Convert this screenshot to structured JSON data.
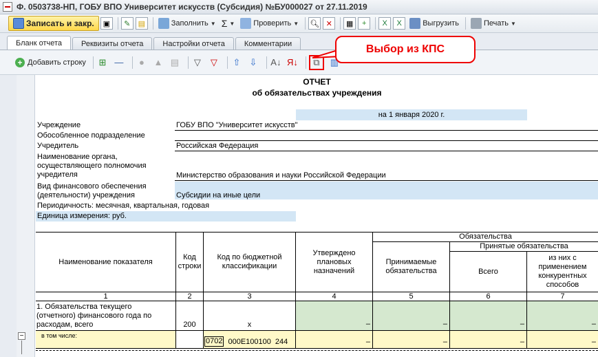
{
  "window": {
    "title": "Ф. 0503738-НП, ГОБУ ВПО Университет искусств (Субсидия) №БУ000027 от 27.11.2019"
  },
  "toolbar": {
    "save_close": "Записать и закр.",
    "fill": "Заполнить",
    "check": "Проверить",
    "upload": "Выгрузить",
    "print": "Печать"
  },
  "tabs": [
    "Бланк отчета",
    "Реквизиты отчета",
    "Настройки отчета",
    "Комментарии"
  ],
  "toolbar2": {
    "add_row": "Добавить строку"
  },
  "callout": "Выбор из КПС",
  "report": {
    "title": "ОТЧЕТ",
    "subtitle": "об обязательствах учреждения",
    "date": "на 1 января 2020 г.",
    "rows": [
      {
        "label": "Учреждение",
        "value": "ГОБУ ВПО \"Университет искусств\""
      },
      {
        "label": "Обособленное подразделение",
        "value": ""
      },
      {
        "label": "Учредитель",
        "value": "Российская Федерация"
      },
      {
        "label": "Наименование органа,\nосуществляющего полномочия\nучредителя",
        "value": "Министерство образования и науки Российской Федерации"
      },
      {
        "label": "Вид финансового обеспечения\n(деятельности) учреждения",
        "value": "Субсидии на иные цели"
      }
    ],
    "periodicity": "Периодичность: месячная, квартальная, годовая",
    "unit": "Единица измерения: руб."
  },
  "table": {
    "headers": {
      "name": "Наименование показателя",
      "code": "Код\nстроки",
      "kbk": "Код по бюджетной\nклассификации",
      "approved": "Утверждено\nплановых\nназначений",
      "obligations": "Обязательства",
      "accepted_group": "Принятые обязательства",
      "acceptable": "Принимаемые\nобязательства",
      "total": "Всего",
      "competitive": "из них с\nприменением\nконкурентных\nспособов"
    },
    "col_numbers": [
      "1",
      "2",
      "3",
      "4",
      "5",
      "6",
      "7"
    ],
    "row1": {
      "name": "1. Обязательства текущего\n(отчетного) финансового года по\nрасходам, всего",
      "code": "200",
      "kbk": "x",
      "dash": "–"
    },
    "row2": {
      "name": "в том числе:",
      "kbk_parts": [
        "0702",
        "000Е100100",
        "244"
      ],
      "dash": "–"
    }
  }
}
